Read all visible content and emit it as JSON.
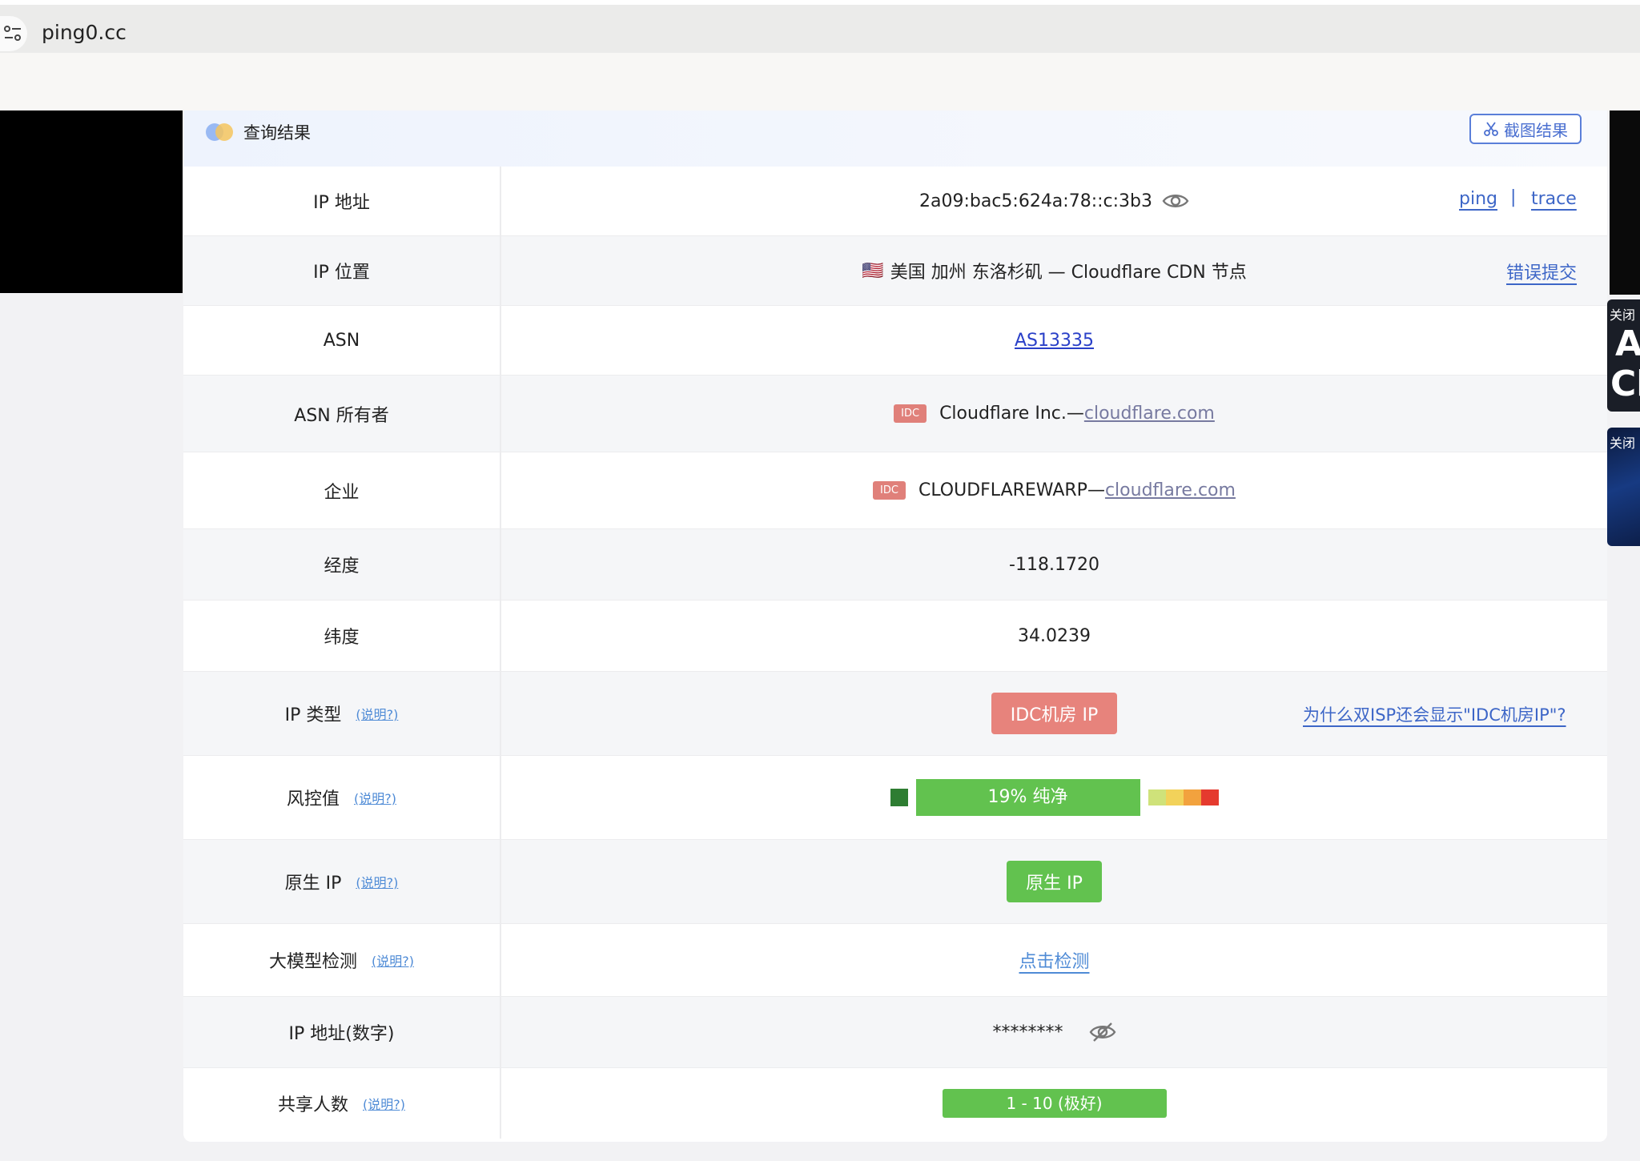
{
  "browser": {
    "url": "ping0.cc"
  },
  "card": {
    "title": "查询结果",
    "screenshot_button": "截图结果"
  },
  "ads": {
    "close_label": "关闭",
    "ad1_letters": [
      "A",
      "Cl"
    ]
  },
  "rows": {
    "ip": {
      "label": "IP 地址",
      "value": "2a09:bac5:624a:78::c:3b3",
      "link_ping": "ping",
      "link_sep": "|",
      "link_trace": "trace"
    },
    "location": {
      "label": "IP 位置",
      "flag": "🇺🇸",
      "value": "美国 加州 东洛杉矶 — Cloudflare CDN 节点",
      "link": "错误提交"
    },
    "asn": {
      "label": "ASN",
      "value": "AS13335"
    },
    "asn_owner": {
      "label": "ASN 所有者",
      "tag": "IDC",
      "name": "Cloudflare Inc.—",
      "domain": "cloudflare.com"
    },
    "org": {
      "label": "企业",
      "tag": "IDC",
      "name": "CLOUDFLAREWARP—",
      "domain": "cloudflare.com"
    },
    "longitude": {
      "label": "经度",
      "value": "-118.1720"
    },
    "latitude": {
      "label": "纬度",
      "value": "34.0239"
    },
    "ip_type": {
      "label": "IP 类型",
      "explain": "(说明?)",
      "value": "IDC机房 IP",
      "link": "为什么双ISP还会显示\"IDC机房IP\"?"
    },
    "risk": {
      "label": "风控值",
      "explain": "(说明?)",
      "value": "19%  纯净",
      "percent": 19
    },
    "native": {
      "label": "原生 IP",
      "explain": "(说明?)",
      "value": "原生 IP"
    },
    "llm": {
      "label": "大模型检测",
      "explain": "(说明?)",
      "value": "点击检测"
    },
    "ip_num": {
      "label": "IP 地址(数字)",
      "value": "********"
    },
    "shared": {
      "label": "共享人数",
      "explain": "(说明?)",
      "value": "1 - 10 (极好)"
    }
  },
  "colors": {
    "accent_blue": "#3d66c7",
    "idc_red": "#e7837c",
    "clean_green": "#62c24f",
    "risk_dark_green": "#2e7d32"
  }
}
